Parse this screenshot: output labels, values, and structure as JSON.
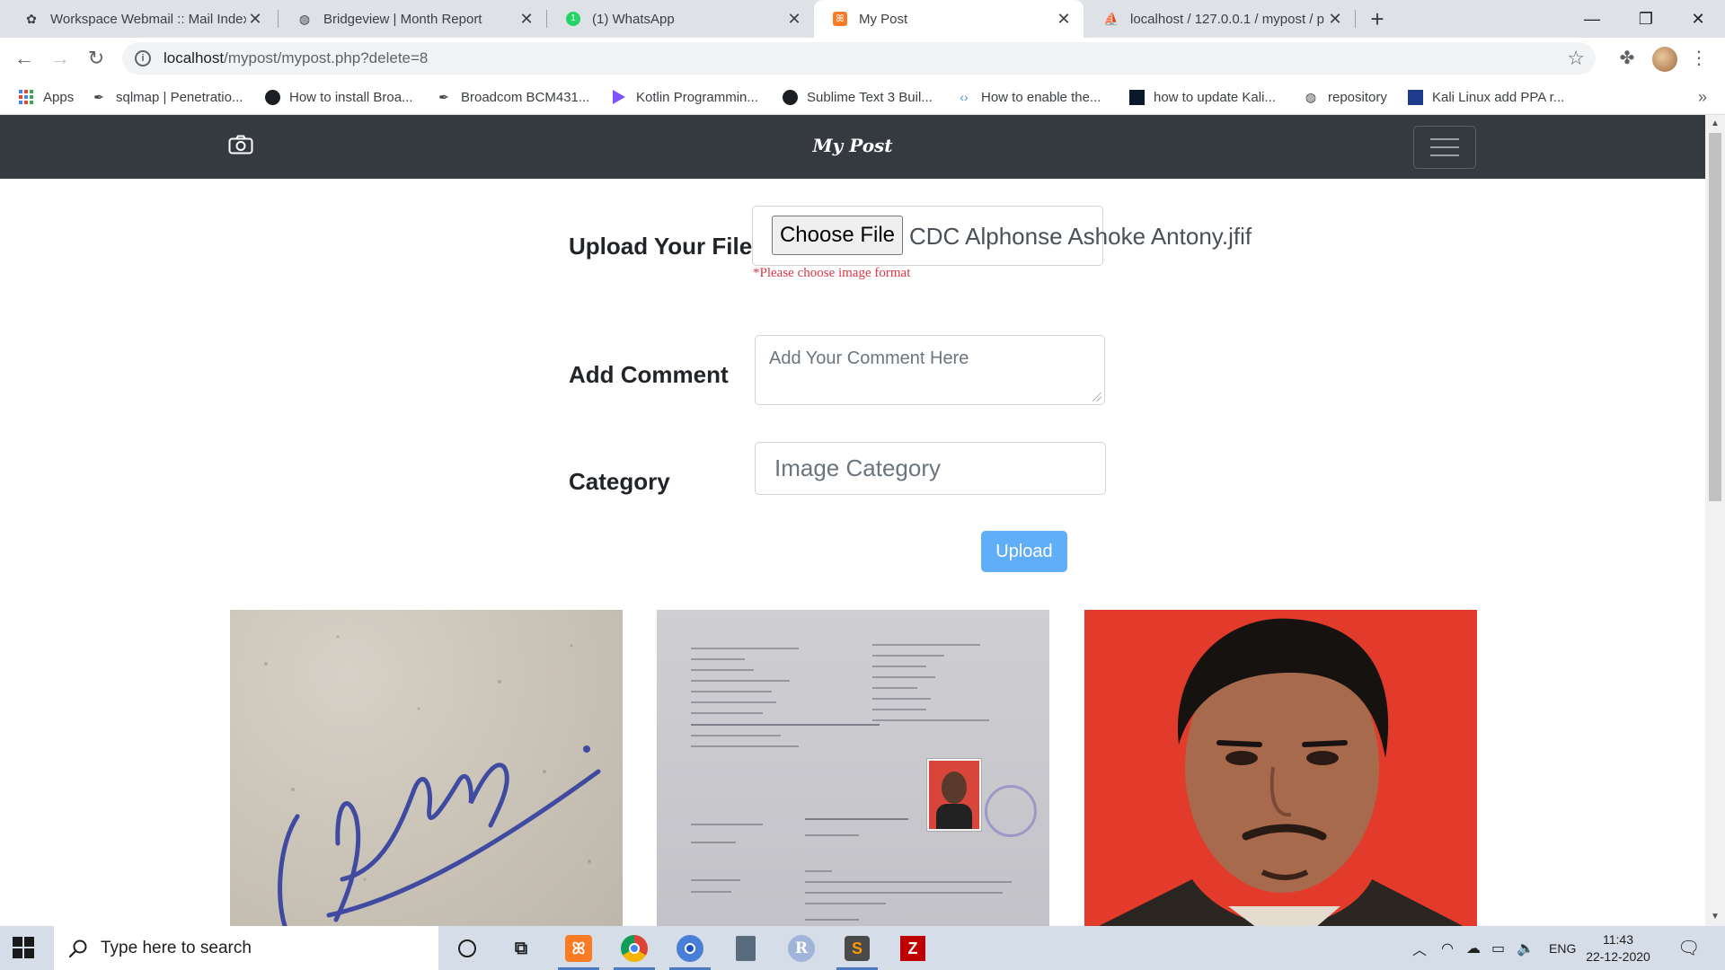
{
  "browser": {
    "tabs": [
      {
        "title": "Workspace Webmail :: Mail Index",
        "icon": "webmail-icon",
        "active": false
      },
      {
        "title": "Bridgeview | Month Report",
        "icon": "globe-icon",
        "active": false
      },
      {
        "title": "(1) WhatsApp",
        "icon": "whatsapp-icon",
        "active": false
      },
      {
        "title": "My Post",
        "icon": "xampp-icon",
        "active": true
      },
      {
        "title": "localhost / 127.0.0.1 / mypost / p",
        "icon": "phpmyadmin-icon",
        "active": false
      }
    ],
    "url_host": "localhost",
    "url_path": "/mypost/mypost.php?delete=8",
    "bookmarks": [
      {
        "label": "Apps",
        "icon": "apps-grid-icon"
      },
      {
        "label": "sqlmap | Penetratio...",
        "icon": "sqlmap-icon"
      },
      {
        "label": "How to install Broa...",
        "icon": "github-icon"
      },
      {
        "label": "Broadcom BCM431...",
        "icon": "sqlmap-icon"
      },
      {
        "label": "Kotlin Programmin...",
        "icon": "kotlin-icon"
      },
      {
        "label": "Sublime Text 3 Buil...",
        "icon": "github-icon"
      },
      {
        "label": "How to enable the...",
        "icon": "link-icon"
      },
      {
        "label": "how to update Kali...",
        "icon": "terminal-icon"
      },
      {
        "label": "repository",
        "icon": "globe-icon"
      },
      {
        "label": "Kali Linux add PPA r...",
        "icon": "kali-icon"
      }
    ]
  },
  "site": {
    "brand": "My Post",
    "form": {
      "file_label": "Upload Your File",
      "choose_button": "Choose File",
      "file_name": "CDC Alphonse Ashoke Antony.jfif",
      "file_hint": "*Please choose image format",
      "comment_label": "Add Comment",
      "comment_placeholder": "Add Your Comment Here",
      "category_label": "Category",
      "category_placeholder": "Image Category",
      "upload_button": "Upload"
    },
    "posts": [
      {
        "kind": "signature-image"
      },
      {
        "kind": "bank-document-image"
      },
      {
        "kind": "portrait-photo"
      }
    ]
  },
  "taskbar": {
    "search_placeholder": "Type here to search",
    "language": "ENG",
    "time": "11:43",
    "date": "22-12-2020",
    "apps": [
      "cortana-icon",
      "task-view-icon",
      "xampp-icon",
      "chrome-icon",
      "chrome-icon",
      "calculator-icon",
      "r-icon",
      "sublime-icon",
      "filezilla-icon"
    ]
  },
  "colors": {
    "navbar": "#343a40",
    "upload_button": "#60adf8",
    "hint_text": "#dc3545"
  }
}
